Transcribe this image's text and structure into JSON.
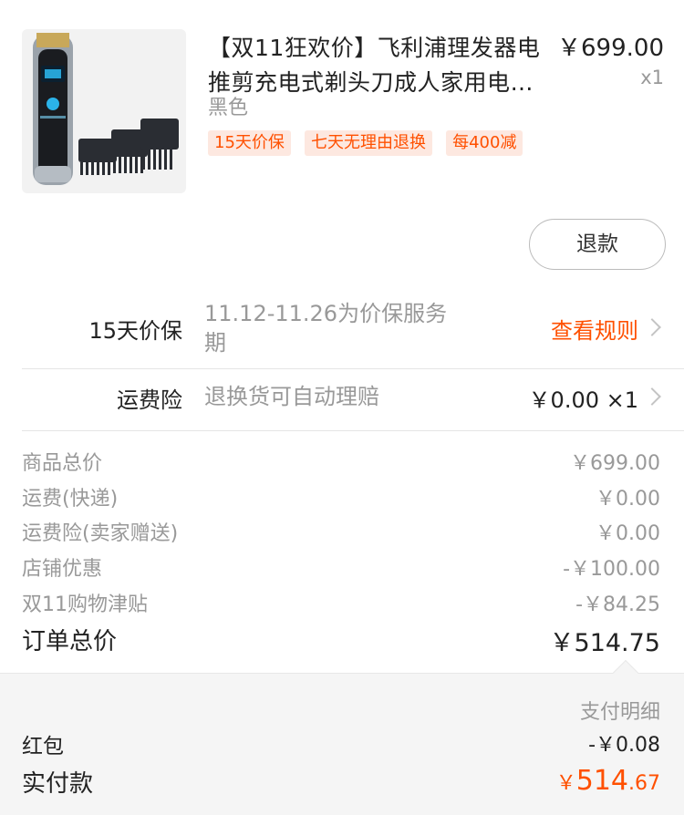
{
  "product": {
    "image_alt": "hair-clipper-product-image",
    "title": "【双11狂欢价】飞利浦理发器电推剪充电式剃头刀成人家用电…",
    "price": "￥699.00",
    "quantity": "x1",
    "color": "黑色",
    "tags": [
      "15天价保",
      "七天无理由退换",
      "每400减"
    ]
  },
  "refund_button": "退款",
  "price_protect": {
    "label": "15天价保",
    "desc": "11.12-11.26为价保服务期",
    "action": "查看规则"
  },
  "shipping_insurance": {
    "label": "运费险",
    "desc": "退换货可自动理赔",
    "value": "￥0.00 ×1"
  },
  "costs": [
    {
      "label": "商品总价",
      "value": "￥699.00"
    },
    {
      "label": "运费(快递)",
      "value": "￥0.00"
    },
    {
      "label": "运费险(卖家赠送)",
      "value": "￥0.00"
    },
    {
      "label": "店铺优惠",
      "value": "-￥100.00"
    },
    {
      "label": "双11购物津贴",
      "value": "-￥84.25"
    }
  ],
  "order_total": {
    "label": "订单总价",
    "value": "￥514.75"
  },
  "payment": {
    "detail_link": "支付明细",
    "hongbao_label": "红包",
    "hongbao_value": "-￥0.08",
    "paid_label": "实付款",
    "paid_currency": "￥",
    "paid_int": "514",
    "paid_dec": ".67"
  },
  "colors": {
    "accent": "#ff5000",
    "muted": "#999999",
    "tag_bg": "#fde8e0"
  }
}
